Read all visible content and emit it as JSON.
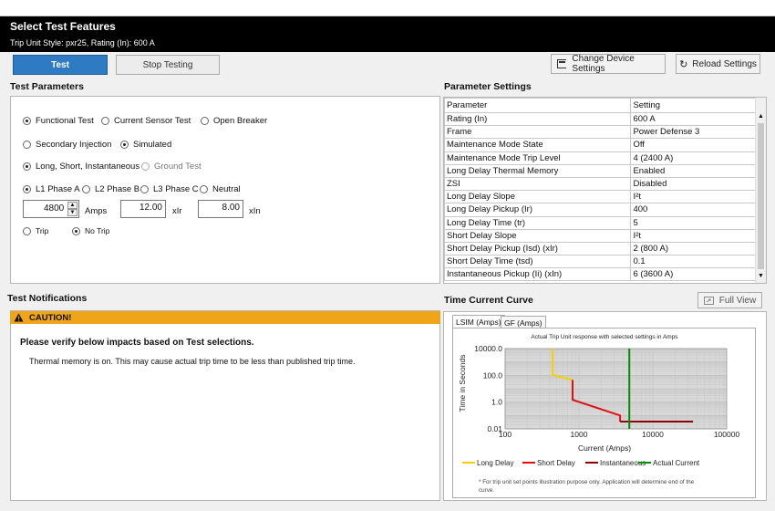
{
  "header": {
    "title": "Select Test Features",
    "subtitle": "Trip Unit Style: pxr25, Rating (In): 600 A"
  },
  "toolbar": {
    "test_label": "Test",
    "stop_label": "Stop Testing",
    "change_label": "Change Device Settings",
    "reload_label": "Reload Settings"
  },
  "test_params": {
    "title": "Test Parameters",
    "mode": [
      "Functional Test",
      "Current Sensor Test",
      "Open Breaker"
    ],
    "injection": [
      "Secondary Injection",
      "Simulated"
    ],
    "protection": [
      "Long, Short, Instantaneous",
      "Ground Test"
    ],
    "phases": [
      "L1 Phase A",
      "L2 Phase B",
      "L3 Phase C",
      "Neutral"
    ],
    "amps_value": "4800",
    "amps_label": "Amps",
    "xir_value": "12.00",
    "xir_label": "xIr",
    "xin_value": "8.00",
    "xin_label": "xIn",
    "trip": [
      "Trip",
      "No Trip"
    ]
  },
  "param_settings": {
    "title": "Parameter Settings",
    "headers": [
      "Parameter",
      "Setting"
    ],
    "rows": [
      [
        "Rating (In)",
        "600 A"
      ],
      [
        "Frame",
        "Power Defense 3"
      ],
      [
        "Maintenance Mode State",
        "Off"
      ],
      [
        "Maintenance Mode Trip Level",
        "4 (2400 A)"
      ],
      [
        "Long Delay Thermal Memory",
        "Enabled"
      ],
      [
        "ZSI",
        "Disabled"
      ],
      [
        "Long Delay Slope",
        "I²t"
      ],
      [
        "Long Delay Pickup (Ir)",
        "400"
      ],
      [
        "Long Delay Time (tr)",
        "5"
      ],
      [
        "Short Delay Slope",
        "I²t"
      ],
      [
        "Short Delay Pickup (Isd) (xIr)",
        "2 (800 A)"
      ],
      [
        "Short Delay Time (tsd)",
        "0.1"
      ],
      [
        "Instantaneous Pickup (Ii) (xIn)",
        "6 (3600 A)"
      ]
    ]
  },
  "notifications": {
    "title": "Test Notifications",
    "caution": "CAUTION!",
    "heading": "Please verify below impacts based on Test selections.",
    "message": "Thermal memory is on. This may cause actual trip time to be less than published trip time."
  },
  "tcc": {
    "title": "Time Current Curve",
    "full_view": "Full View",
    "tabs": [
      "LSIM (Amps)",
      "GF (Amps)"
    ],
    "footnote": "* For trip unit set points illustration purpose only. Application will determine end of the curve."
  },
  "chart_data": {
    "type": "line",
    "title": "Actual Trip Unit response with selected settings in Amps",
    "xlabel": "Current (Amps)",
    "ylabel": "Time in Seconds",
    "xscale": "log",
    "yscale": "log",
    "xlim": [
      100,
      100000
    ],
    "ylim": [
      0.01,
      10000
    ],
    "x_ticks": [
      "100",
      "1000",
      "10000",
      "100000"
    ],
    "y_ticks": [
      "0.01",
      "1.0",
      "100.0",
      "10000.0"
    ],
    "grid": true,
    "legend": "bottom",
    "series": [
      {
        "name": "Long Delay",
        "color": "#f5d000",
        "points": [
          [
            440,
            10000
          ],
          [
            440,
            110
          ],
          [
            820,
            45
          ]
        ]
      },
      {
        "name": "Short Delay",
        "color": "#e01010",
        "points": [
          [
            820,
            45
          ],
          [
            820,
            1.5
          ],
          [
            3600,
            0.1
          ],
          [
            3600,
            0.035
          ]
        ]
      },
      {
        "name": "Instantaneous",
        "color": "#8b0000",
        "points": [
          [
            3600,
            0.035
          ],
          [
            35000,
            0.035
          ]
        ]
      },
      {
        "name": "Actual Current",
        "color": "#0a8a0a",
        "points": [
          [
            4800,
            10000
          ],
          [
            4800,
            0.01
          ]
        ]
      }
    ]
  },
  "colors": {
    "accent": "#2f7bc3",
    "caution": "#f0a419",
    "header_bg": "#000000"
  }
}
